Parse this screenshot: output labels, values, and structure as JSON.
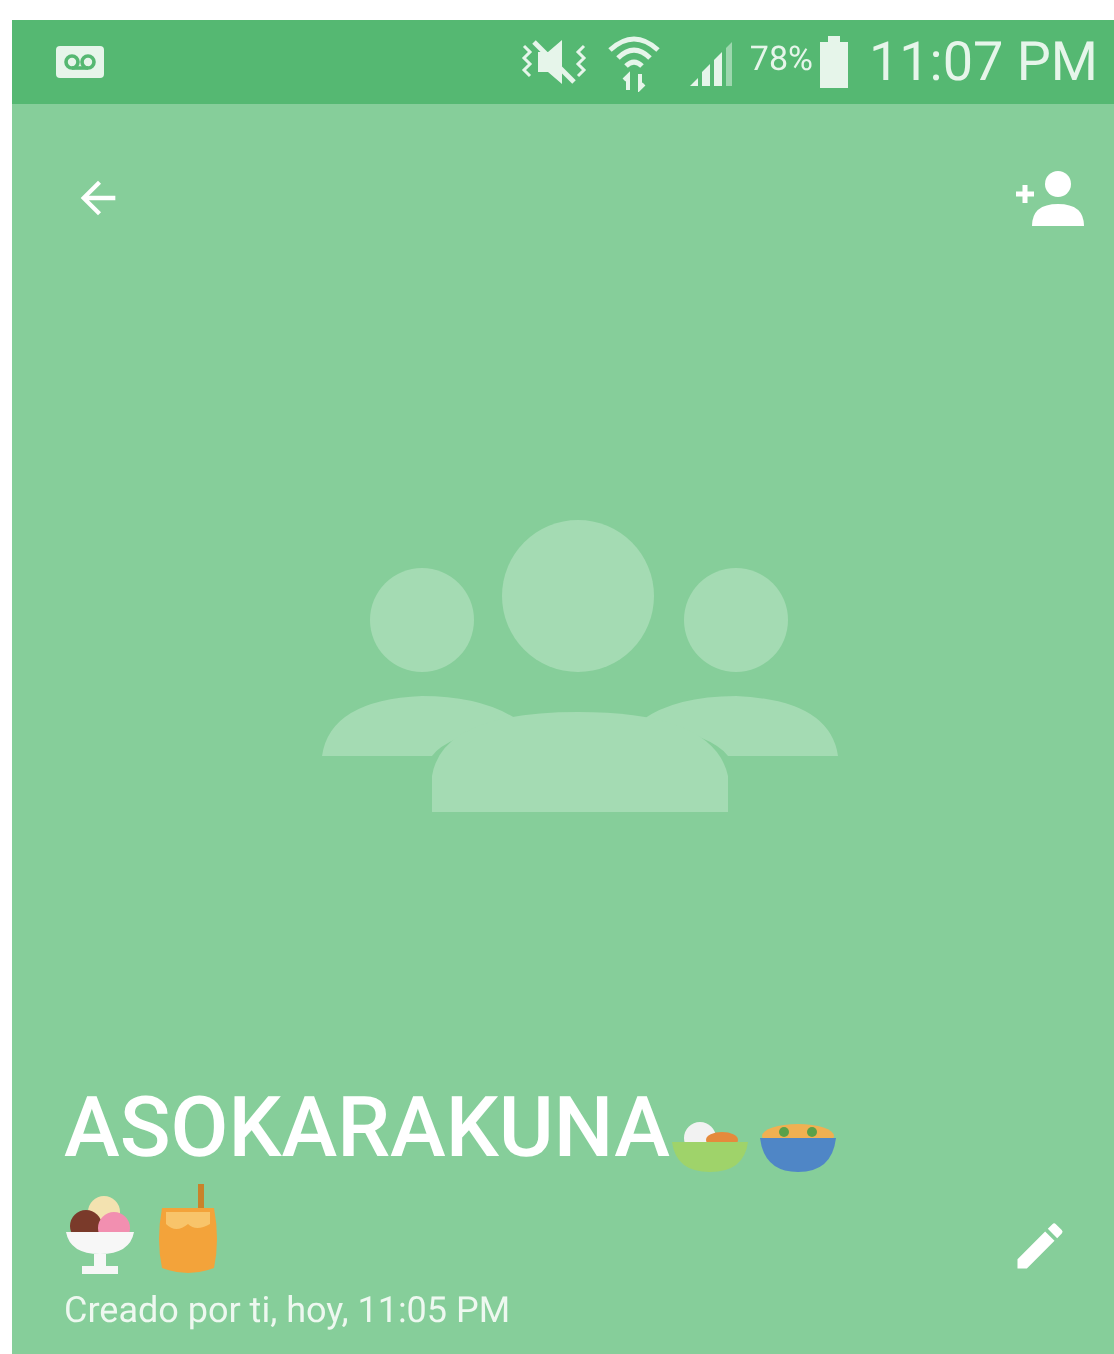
{
  "status_bar": {
    "battery_percent": "78%",
    "time": "11:07 PM"
  },
  "group": {
    "name": "ASOKARAKUNA",
    "created": "Creado por ti, hoy, 11:05 PM"
  }
}
